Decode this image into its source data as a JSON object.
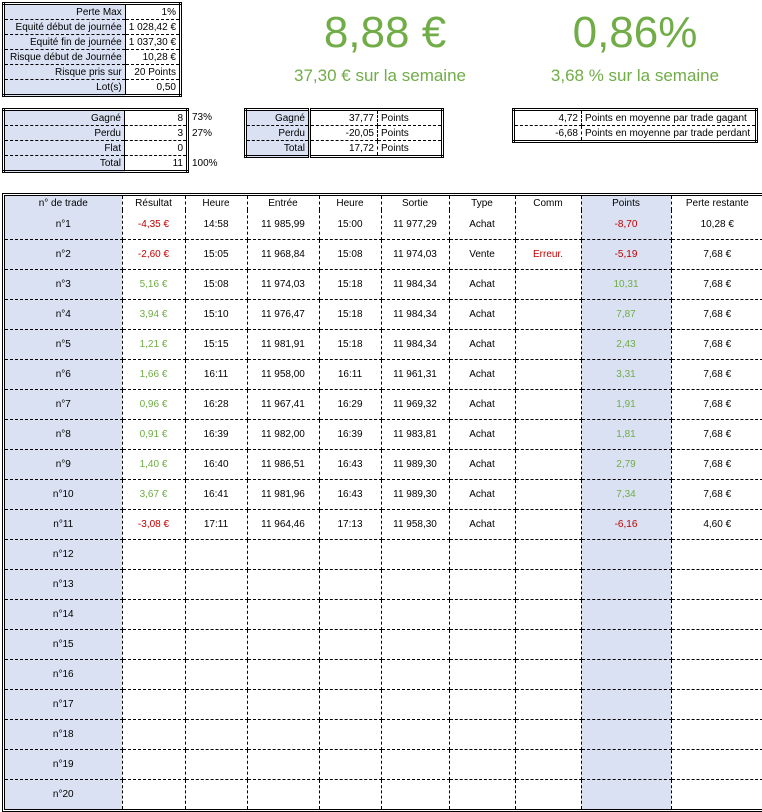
{
  "top_params": [
    {
      "label": "Perte Max",
      "value": "1%"
    },
    {
      "label": "Equité début de journée",
      "value": "1 028,42 €"
    },
    {
      "label": "Equité fin de journée",
      "value": "1 037,30 €"
    },
    {
      "label": "Risque début de Journée",
      "value": "10,28 €"
    },
    {
      "label": "Risque pris sur",
      "value": "20 Points"
    },
    {
      "label": "Lot(s)",
      "value": "0,50"
    }
  ],
  "headline": {
    "day_amount": "8,88 €",
    "week_amount": "37,30 € sur la semaine",
    "day_percent": "0,86%",
    "week_percent": "3,68 % sur la semaine"
  },
  "win_loss": [
    {
      "label": "Gagné",
      "count": "8",
      "pct": "73%"
    },
    {
      "label": "Perdu",
      "count": "3",
      "pct": "27%"
    },
    {
      "label": "Flat",
      "count": "0",
      "pct": ""
    },
    {
      "label": "Total",
      "count": "11",
      "pct": "100%"
    }
  ],
  "points_summary": [
    {
      "label": "Gagné",
      "value": "37,77",
      "unit": "Points"
    },
    {
      "label": "Perdu",
      "value": "-20,05",
      "unit": "Points"
    },
    {
      "label": "Total",
      "value": "17,72",
      "unit": "Points"
    }
  ],
  "averages": [
    {
      "value": "4,72",
      "text": "Points en moyenne par trade gagant"
    },
    {
      "value": "-6,68",
      "text": "Points en moyenne par trade perdant"
    }
  ],
  "table": {
    "headers": [
      "n° de trade",
      "Résultat",
      "Heure",
      "Entrée",
      "Heure",
      "Sortie",
      "Type",
      "Comm",
      "Points",
      "Perte restante"
    ],
    "rows": [
      {
        "id": "n°1",
        "res": "-4,35 €",
        "res_c": "red",
        "h1": "14:58",
        "in": "11 985,99",
        "h2": "15:00",
        "out": "11 977,29",
        "type": "Achat",
        "comm": "",
        "pts": "-8,70",
        "pts_c": "red",
        "left": "10,28 €"
      },
      {
        "id": "n°2",
        "res": "-2,60 €",
        "res_c": "red",
        "h1": "15:05",
        "in": "11 968,84",
        "h2": "15:08",
        "out": "11 974,03",
        "type": "Vente",
        "comm": "Erreur.",
        "pts": "-5,19",
        "pts_c": "red",
        "left": "7,68 €"
      },
      {
        "id": "n°3",
        "res": "5,16 €",
        "res_c": "green",
        "h1": "15:08",
        "in": "11 974,03",
        "h2": "15:18",
        "out": "11 984,34",
        "type": "Achat",
        "comm": "",
        "pts": "10,31",
        "pts_c": "green",
        "left": "7,68 €"
      },
      {
        "id": "n°4",
        "res": "3,94 €",
        "res_c": "green",
        "h1": "15:10",
        "in": "11 976,47",
        "h2": "15:18",
        "out": "11 984,34",
        "type": "Achat",
        "comm": "",
        "pts": "7,87",
        "pts_c": "green",
        "left": "7,68 €"
      },
      {
        "id": "n°5",
        "res": "1,21 €",
        "res_c": "green",
        "h1": "15:15",
        "in": "11 981,91",
        "h2": "15:18",
        "out": "11 984,34",
        "type": "Achat",
        "comm": "",
        "pts": "2,43",
        "pts_c": "green",
        "left": "7,68 €"
      },
      {
        "id": "n°6",
        "res": "1,66 €",
        "res_c": "green",
        "h1": "16:11",
        "in": "11 958,00",
        "h2": "16:11",
        "out": "11 961,31",
        "type": "Achat",
        "comm": "",
        "pts": "3,31",
        "pts_c": "green",
        "left": "7,68 €"
      },
      {
        "id": "n°7",
        "res": "0,96 €",
        "res_c": "green",
        "h1": "16:28",
        "in": "11 967,41",
        "h2": "16:29",
        "out": "11 969,32",
        "type": "Achat",
        "comm": "",
        "pts": "1,91",
        "pts_c": "green",
        "left": "7,68 €"
      },
      {
        "id": "n°8",
        "res": "0,91 €",
        "res_c": "green",
        "h1": "16:39",
        "in": "11 982,00",
        "h2": "16:39",
        "out": "11 983,81",
        "type": "Achat",
        "comm": "",
        "pts": "1,81",
        "pts_c": "green",
        "left": "7,68 €"
      },
      {
        "id": "n°9",
        "res": "1,40 €",
        "res_c": "green",
        "h1": "16:40",
        "in": "11 986,51",
        "h2": "16:43",
        "out": "11 989,30",
        "type": "Achat",
        "comm": "",
        "pts": "2,79",
        "pts_c": "green",
        "left": "7,68 €"
      },
      {
        "id": "n°10",
        "res": "3,67 €",
        "res_c": "green",
        "h1": "16:41",
        "in": "11 981,96",
        "h2": "16:43",
        "out": "11 989,30",
        "type": "Achat",
        "comm": "",
        "pts": "7,34",
        "pts_c": "green",
        "left": "7,68 €"
      },
      {
        "id": "n°11",
        "res": "-3,08 €",
        "res_c": "red",
        "h1": "17:11",
        "in": "11 964,46",
        "h2": "17:13",
        "out": "11 958,30",
        "type": "Achat",
        "comm": "",
        "pts": "-6,16",
        "pts_c": "red",
        "left": "4,60 €"
      },
      {
        "id": "n°12"
      },
      {
        "id": "n°13"
      },
      {
        "id": "n°14"
      },
      {
        "id": "n°15"
      },
      {
        "id": "n°16"
      },
      {
        "id": "n°17"
      },
      {
        "id": "n°18"
      },
      {
        "id": "n°19"
      },
      {
        "id": "n°20"
      }
    ]
  },
  "colors": {
    "accent_green": "#70ad47",
    "loss_red": "#c00000",
    "cell_blue": "#d9e1f2"
  }
}
